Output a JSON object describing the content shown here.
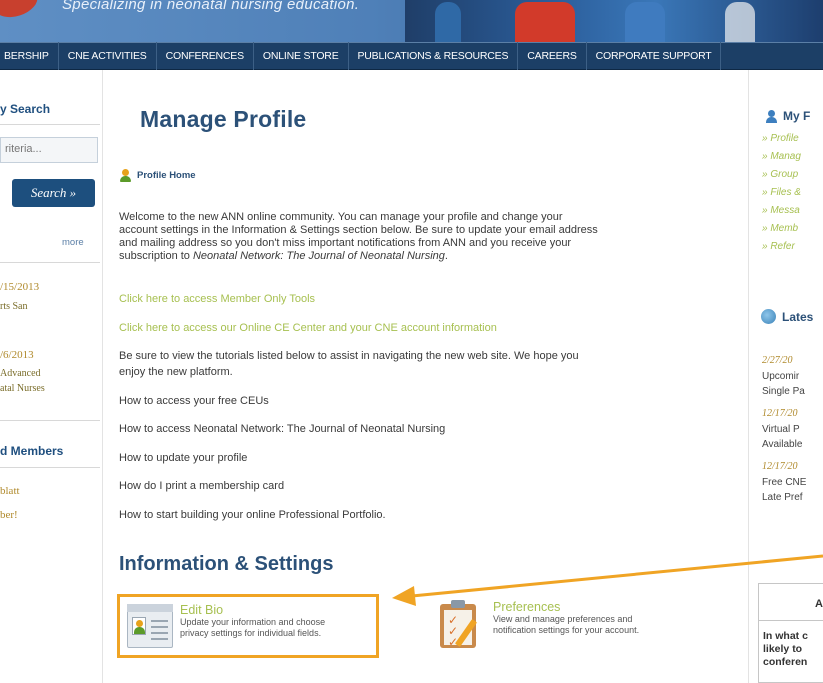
{
  "banner": {
    "tagline": "Specializing in neonatal nursing education."
  },
  "nav": [
    "BERSHIP",
    "CNE ACTIVITIES",
    "CONFERENCES",
    "ONLINE STORE",
    "PUBLICATIONS & RESOURCES",
    "CAREERS",
    "CORPORATE SUPPORT"
  ],
  "left": {
    "search_heading": "y Search",
    "search_placeholder": "riteria...",
    "search_button": "Search »",
    "more": "more",
    "events": [
      {
        "date": "/15/2013",
        "lines": [
          "rts San"
        ]
      },
      {
        "date": "/6/2013",
        "lines": [
          "Advanced",
          "atal Nurses"
        ]
      }
    ],
    "members_heading": "d Members",
    "members": [
      "blatt",
      "ber!"
    ]
  },
  "main": {
    "title": "Manage Profile",
    "profile_home": "Profile Home",
    "welcome": {
      "line1": "Welcome to the new ANN online community. You can manage your profile and change your",
      "line2": "account settings in the Information & Settings section below. Be sure to update your email address",
      "line3": "and mailing address so you don't miss important notifications from ANN and you receive your",
      "line4_pre": "subscription to ",
      "line4_ital": "Neonatal Network: The Journal of Neonatal Nursing",
      "line4_post": "."
    },
    "link_member_tools": "Click here to access Member Only Tools",
    "link_ce_center": "Click here to access our Online CE Center and your CNE account information",
    "tutorials_line1": "Be sure to view the tutorials listed below to assist in navigating the new web site. We hope you",
    "tutorials_line2": "enjoy the new platform.",
    "tutorials": [
      "How to access your free CEUs",
      "How to access Neonatal Network: The Journal of Neonatal Nursing",
      "How to update your profile",
      "How do I print a membership card",
      "How to start building your online Professional Portfolio."
    ],
    "section_title": "Information & Settings",
    "edit_bio": {
      "title": "Edit Bio",
      "desc1": "Update your information and choose",
      "desc2": "privacy settings for individual fields."
    },
    "preferences": {
      "title": "Preferences",
      "desc1": "View and manage preferences and",
      "desc2": "notification settings for your account."
    }
  },
  "right": {
    "my_heading": "My F",
    "links": [
      "» Profile",
      "» Manag",
      "» Group",
      "» Files &",
      "» Messa",
      "» Memb",
      "» Refer"
    ],
    "latest_heading": "Lates",
    "news": [
      {
        "date": "2/27/20",
        "lines": [
          "Upcomir",
          "Single Pa"
        ]
      },
      {
        "date": "12/17/20",
        "lines": [
          "Virtual P",
          "Available"
        ]
      },
      {
        "date": "12/17/20",
        "lines": [
          "Free CNE",
          "Late Pref"
        ]
      }
    ],
    "poll_heading": "Al",
    "poll_question": [
      "In what c",
      "likely to",
      "conferen"
    ]
  },
  "colors": {
    "nav_bg": "#1c3f66",
    "title": "#2c5178",
    "link_green": "#a7c051",
    "highlight": "#f0a424"
  },
  "icons": [
    "person-icon",
    "bio-card-icon",
    "clipboard-checklist-icon",
    "globe-icon",
    "arrow-annotation"
  ]
}
